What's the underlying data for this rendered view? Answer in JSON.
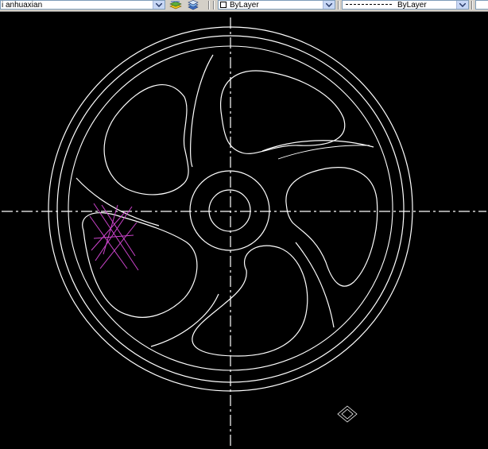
{
  "toolbar": {
    "layer_value": "i anhuaxian",
    "color_value": "ByLayer",
    "linetype_value": "ByLayer"
  },
  "drawing": {
    "colors": {
      "background": "#000000",
      "geometry": "#ffffff",
      "hatch": "#cc44cc"
    },
    "icons": [
      "layer-manager-icon",
      "layer-states-icon",
      "ucs-icon"
    ]
  }
}
